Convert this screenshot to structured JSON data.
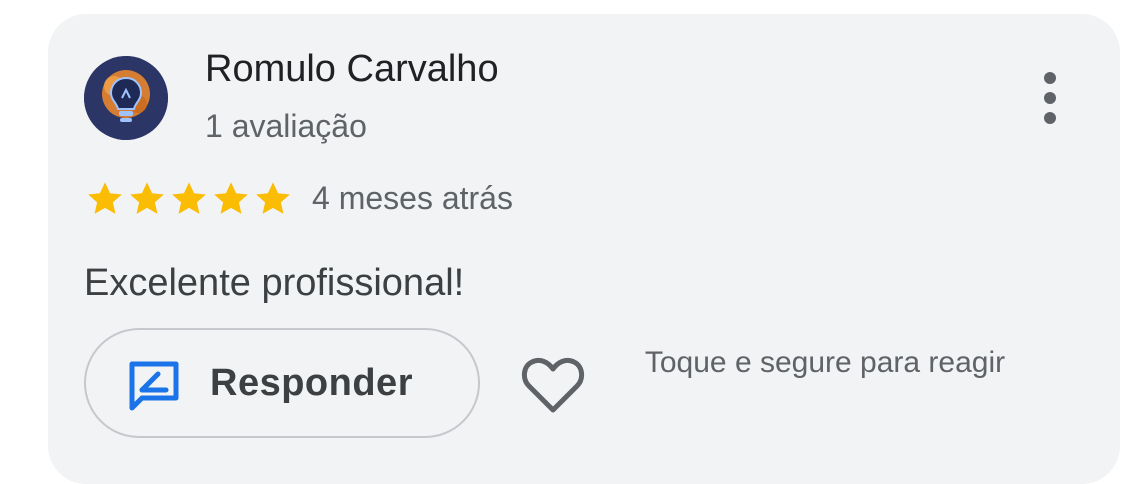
{
  "review": {
    "author_name": "Romulo Carvalho",
    "review_count": "1 avaliação",
    "rating": 5,
    "max_rating": 5,
    "time_ago": "4 meses atrás",
    "text": "Excelente profissional!"
  },
  "actions": {
    "reply_label": "Responder",
    "react_hint": "Toque e segure para reagir"
  },
  "icons": {
    "more": "more-vert-icon",
    "star": "star-icon",
    "reply": "reply-icon",
    "heart": "heart-icon"
  },
  "colors": {
    "card_background": "#f1f3f4",
    "star": "#fbbc04",
    "reply_icon": "#1a73e8",
    "avatar_background": "#2b3566",
    "avatar_accent": "#e8862e"
  }
}
